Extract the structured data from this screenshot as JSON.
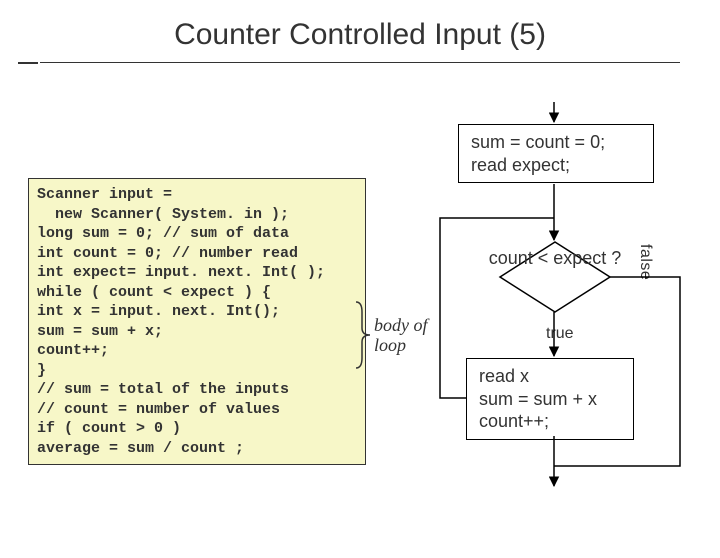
{
  "title": "Counter Controlled Input (5)",
  "code": "Scanner input =\n  new Scanner( System. in );\nlong sum = 0; // sum of data\nint count = 0; // number read\nint expect= input. next. Int( );\nwhile ( count < expect ) {\nint x = input. next. Int();\nsum = sum + x;\ncount++;\n}\n// sum = total of the inputs\n// count = number of values\nif ( count > 0 )\naverage = sum / count ;",
  "body_label": "body of\nloop",
  "flow": {
    "init": "sum = count = 0;\nread expect;",
    "decision": "count < expect ?",
    "loop_body": "read x\nsum = sum + x\ncount++;",
    "true_label": "true",
    "false_label": "false"
  }
}
